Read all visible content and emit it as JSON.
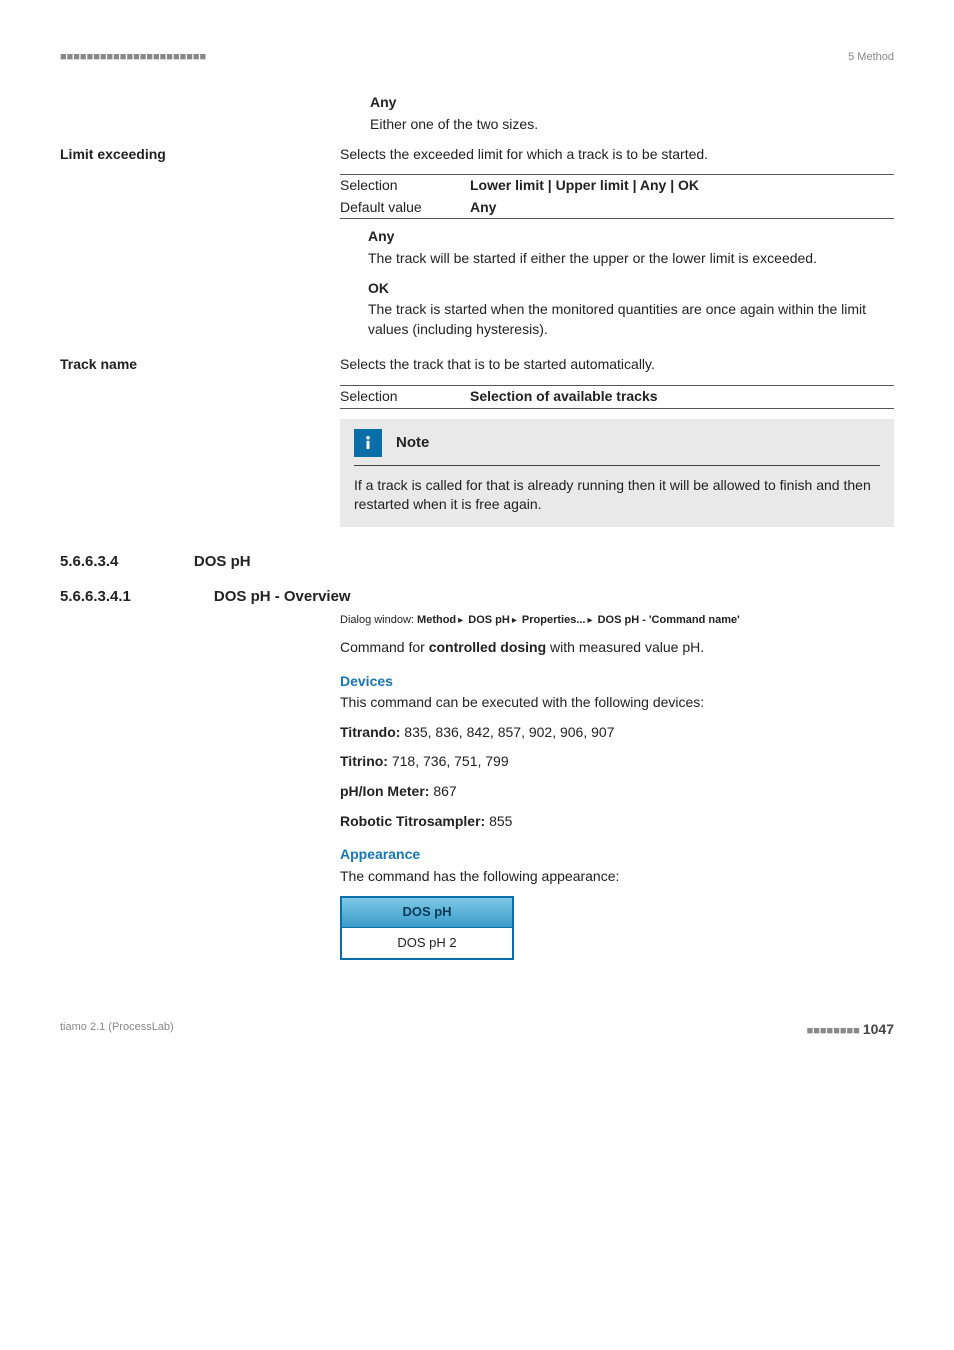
{
  "header": {
    "left": "■■■■■■■■■■■■■■■■■■■■■■",
    "right": "5 Method"
  },
  "any_block": {
    "title": "Any",
    "desc": "Either one of the two sizes."
  },
  "limit_exceeding": {
    "label": "Limit exceeding",
    "intro": "Selects the exceeded limit for which a track is to be started.",
    "table": {
      "k1": "Selection",
      "v1": "Lower limit | Upper limit | Any | OK",
      "k2": "Default value",
      "v2": "Any"
    },
    "any": {
      "title": "Any",
      "desc": "The track will be started if either the upper or the lower limit is exceeded."
    },
    "ok": {
      "title": "OK",
      "desc": "The track is started when the monitored quantities are once again within the limit values (including hysteresis)."
    }
  },
  "track_name": {
    "label": "Track name",
    "intro": "Selects the track that is to be started automatically.",
    "table": {
      "k1": "Selection",
      "v1": "Selection of available tracks"
    },
    "note_title": "Note",
    "note_body": "If a track is called for that is already running then it will be allowed to finish and then restarted when it is free again."
  },
  "sec1": {
    "num": "5.6.6.3.4",
    "title": "DOS pH"
  },
  "sec2": {
    "num": "5.6.6.3.4.1",
    "title": "DOS pH - Overview",
    "dialog_prefix": "Dialog window: ",
    "dialog_parts": {
      "a": "Method",
      "b": "DOS pH",
      "c": "Properties...",
      "d": "DOS pH - 'Command name'"
    },
    "cmd_desc_pre": "Command for ",
    "cmd_desc_bold": "controlled dosing",
    "cmd_desc_post": " with measured value pH.",
    "devices_head": "Devices",
    "devices_intro": "This command can be executed with the following devices:",
    "titrando_label": "Titrando:",
    "titrando_val": " 835, 836, 842, 857, 902, 906, 907",
    "titrino_label": "Titrino:",
    "titrino_val": " 718, 736, 751, 799",
    "phion_label": "pH/Ion Meter:",
    "phion_val": " 867",
    "robotic_label": "Robotic Titrosampler:",
    "robotic_val": " 855",
    "appearance_head": "Appearance",
    "appearance_intro": "The command has the following appearance:",
    "box_top": "DOS pH",
    "box_bot": "DOS pH 2"
  },
  "footer": {
    "left": "tiamo 2.1 (ProcessLab)",
    "bars": "■■■■■■■■",
    "page": "1047"
  }
}
